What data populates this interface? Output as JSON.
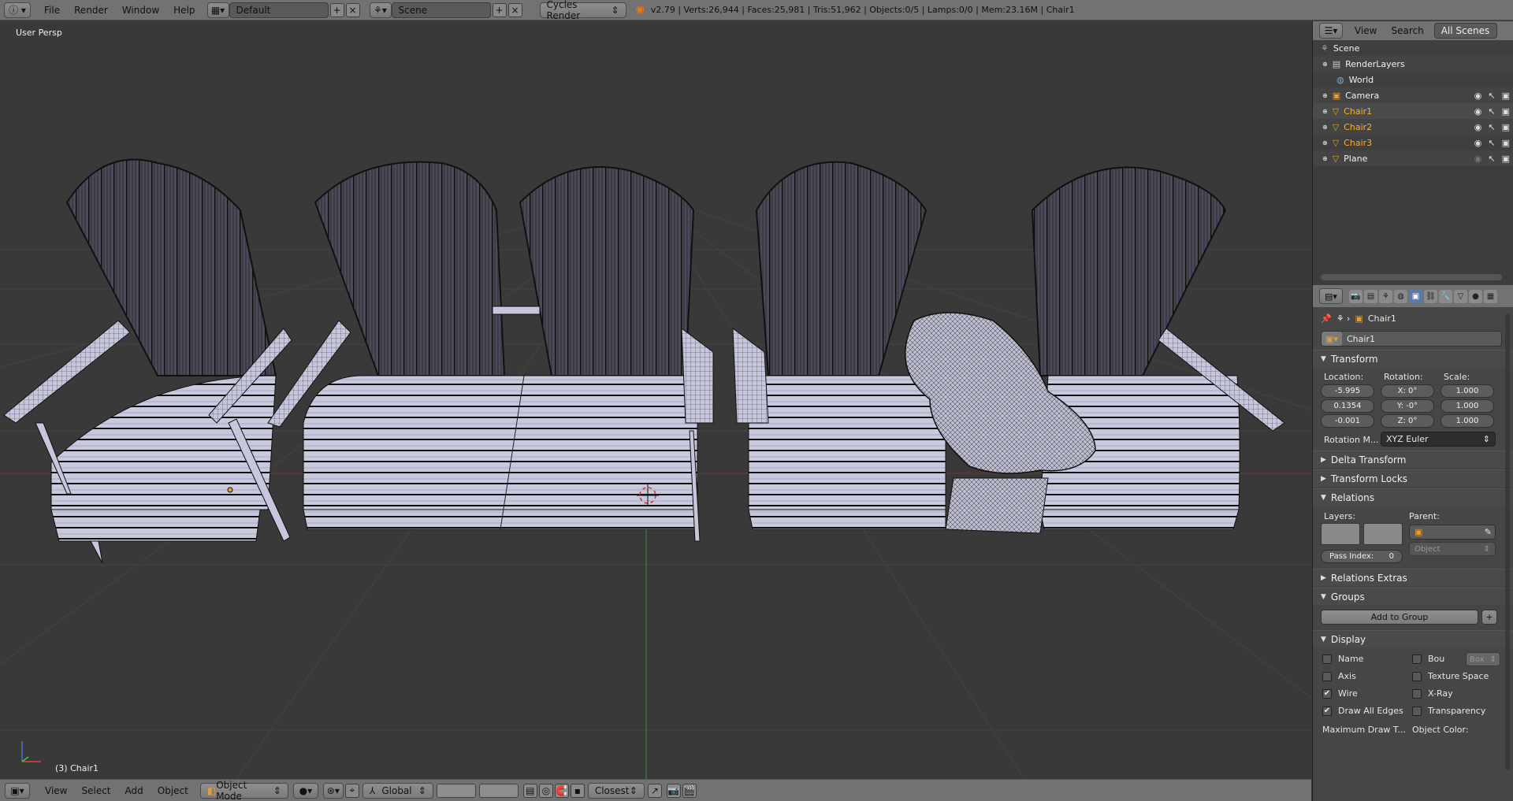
{
  "top_bar": {
    "menus": [
      "File",
      "Render",
      "Window",
      "Help"
    ],
    "screen_layout": "Default",
    "scene": "Scene",
    "render_engine": "Cycles Render",
    "stats": "v2.79 | Verts:26,944 | Faces:25,981 | Tris:51,962 | Objects:0/5 | Lamps:0/0 | Mem:23.16M | Chair1"
  },
  "viewport": {
    "view_label": "User Persp",
    "active_object_label": "(3) Chair1"
  },
  "bottom_bar": {
    "menus": [
      "View",
      "Select",
      "Add",
      "Object"
    ],
    "mode": "Object Mode",
    "orientation": "Global",
    "snap_target": "Closest"
  },
  "outliner": {
    "tabs": [
      "View",
      "Search"
    ],
    "display_mode": "All Scenes",
    "items": [
      {
        "name": "Scene",
        "icon": "scene-icon",
        "active": false
      },
      {
        "name": "RenderLayers",
        "icon": "render-layers-icon",
        "active": false
      },
      {
        "name": "World",
        "icon": "world-icon",
        "active": false
      },
      {
        "name": "Camera",
        "icon": "camera-icon",
        "active": false
      },
      {
        "name": "Chair1",
        "icon": "mesh-icon",
        "active": true
      },
      {
        "name": "Chair2",
        "icon": "mesh-icon",
        "active": true
      },
      {
        "name": "Chair3",
        "icon": "mesh-icon",
        "active": true
      },
      {
        "name": "Plane",
        "icon": "mesh-icon",
        "active": false
      }
    ]
  },
  "properties": {
    "breadcrumb": "Chair1",
    "object_name": "Chair1",
    "transform": {
      "title": "Transform",
      "location_label": "Location:",
      "rotation_label": "Rotation:",
      "scale_label": "Scale:",
      "location": [
        "-5.995",
        "0.1354",
        "-0.001"
      ],
      "rotation": [
        "X:",
        "0°",
        "Y:",
        "-0°",
        "Z:",
        "0°"
      ],
      "scale": [
        "1.000",
        "1.000",
        "1.000"
      ],
      "rotation_mode_label": "Rotation M...",
      "rotation_mode": "XYZ Euler"
    },
    "panels_collapsed": [
      "Delta Transform",
      "Transform Locks"
    ],
    "relations": {
      "title": "Relations",
      "layers_label": "Layers:",
      "parent_label": "Parent:",
      "parent_type": "Object",
      "pass_index_label": "Pass Index:",
      "pass_index": "0"
    },
    "relations_extras": "Relations Extras",
    "groups": {
      "title": "Groups",
      "add_button": "Add to Group"
    },
    "display": {
      "title": "Display",
      "left": [
        {
          "label": "Name",
          "checked": false
        },
        {
          "label": "Axis",
          "checked": false
        },
        {
          "label": "Wire",
          "checked": true
        },
        {
          "label": "Draw All Edges",
          "checked": true
        }
      ],
      "right": [
        {
          "label": "Bou",
          "checked": false
        },
        {
          "label": "Texture Space",
          "checked": false
        },
        {
          "label": "X-Ray",
          "checked": false
        },
        {
          "label": "Transparency",
          "checked": false
        }
      ],
      "bounds_type": "Box",
      "max_draw_label": "Maximum Draw T...",
      "object_color_label": "Object Color:"
    }
  },
  "colors": {
    "background": "#393939",
    "header": "#727272",
    "mesh_face": "#c8c8e0",
    "mesh_wire": "#000000",
    "active": "#ffaf29",
    "accent_blue": "#5a7aa8"
  }
}
